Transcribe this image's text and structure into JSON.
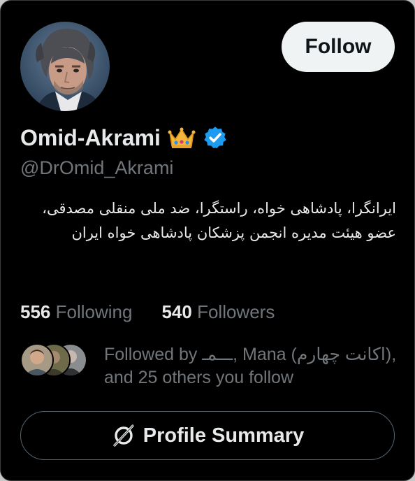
{
  "profile": {
    "name": "Omid-Akrami",
    "handle": "@DrOmid_Akrami",
    "bio": "ایرانگرا، پادشاهی خواه، راستگرا، ضد ملی منقلی مصدقی، عضو هیئت مدیره انجمن پزشکان پادشاهی خواه ایران",
    "crown_icon": "crown-emoji",
    "verified_icon": "verified-badge-icon",
    "verified_color": "#1d9bf0"
  },
  "actions": {
    "follow_label": "Follow",
    "profile_summary_label": "Profile Summary",
    "profile_summary_icon": "grok-slash-circle-icon"
  },
  "stats": {
    "following_count": "556",
    "following_label": "Following",
    "followers_count": "540",
    "followers_label": "Followers"
  },
  "followed_by": {
    "line1": "Followed by ـــمـ, Mana (اکانت چهارم),",
    "line2": "and 25 others you follow"
  },
  "colors": {
    "background": "#000000",
    "primary_text": "#e7e9ea",
    "secondary_text": "#71767b",
    "follow_button_bg": "#eff3f4",
    "border": "#536471"
  }
}
